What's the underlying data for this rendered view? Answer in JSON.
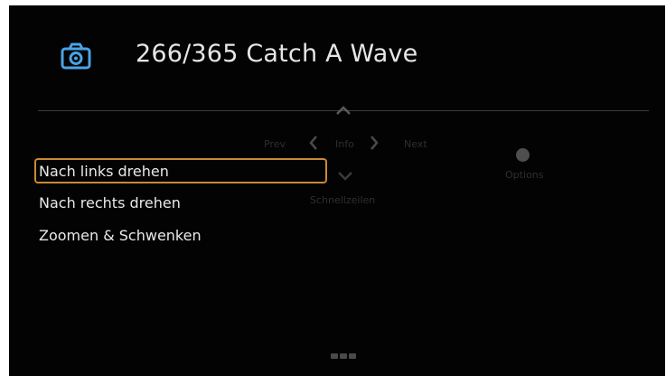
{
  "header": {
    "title": "266/365 Catch A Wave",
    "icon": "camera-icon",
    "icon_color": "#4aa3e6"
  },
  "navigation_overlay": {
    "prev_label": "Prev",
    "info_label": "Info",
    "next_label": "Next",
    "quick_label": "Schnellzeilen",
    "options_label": "Options",
    "up_icon": "chevron-up-icon",
    "left_icon": "chevron-left-icon",
    "right_icon": "chevron-right-icon",
    "down_icon": "chevron-down-icon",
    "options_icon": "dot-icon"
  },
  "menu": {
    "items": [
      {
        "label": "Nach links drehen",
        "selected": true
      },
      {
        "label": "Nach rechts drehen",
        "selected": false
      },
      {
        "label": "Zoomen & Schwenken",
        "selected": false
      }
    ],
    "highlight_color": "#c98a32"
  },
  "footer": {
    "handle_icon": "drag-handle-icon"
  }
}
